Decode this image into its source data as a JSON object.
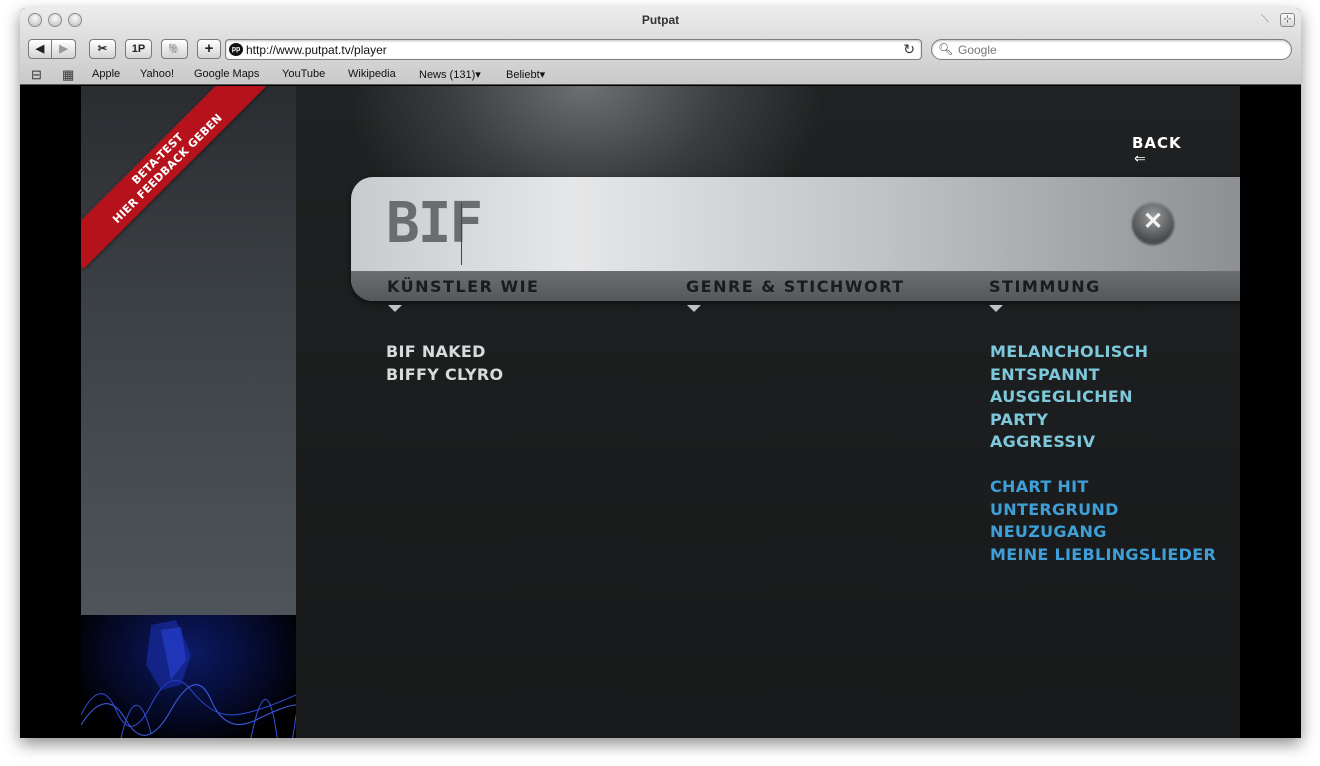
{
  "window": {
    "title": "Putpat"
  },
  "toolbar": {
    "back_icon": "◀",
    "forward_icon": "▶",
    "snippet_icon": "✂",
    "onepassword": "1P",
    "evernote_icon": "🐘",
    "add_icon": "+",
    "url": "http://www.putpat.tv/player",
    "reload_icon": "↻",
    "search_placeholder": "Google"
  },
  "bookmarks": {
    "reading_icon": "📖",
    "grid_icon": "▦",
    "items": [
      "Apple",
      "Yahoo!",
      "Google Maps",
      "YouTube",
      "Wikipedia",
      "News (131)▾",
      "Beliebt▾"
    ]
  },
  "page": {
    "beta_banner": "BETA-TEST\nHIER FEEDBACK GEBEN",
    "back_label": "BACK",
    "back_arrow": "⇐",
    "query": "BIF",
    "clear_icon": "✕",
    "columns": {
      "artists_header": "KÜNSTLER  WIE",
      "genre_header": "GENRE & STICHWORT",
      "mood_header": "STIMMUNG"
    },
    "artists": [
      "BIF NAKED",
      "BIFFY CLYRO"
    ],
    "moods": [
      "MELANCHOLISCH",
      "ENTSPANNT",
      "AUSGEGLICHEN",
      "PARTY",
      "AGGRESSIV"
    ],
    "tags": [
      "CHART HIT",
      "UNTERGRUND",
      "NEUZUGANG",
      "MEINE LIEBLINGSLIEDER"
    ]
  },
  "colors": {
    "mood_text": "#7ec8dc",
    "tag_text": "#3f9fd8",
    "banner": "#b5121b"
  }
}
